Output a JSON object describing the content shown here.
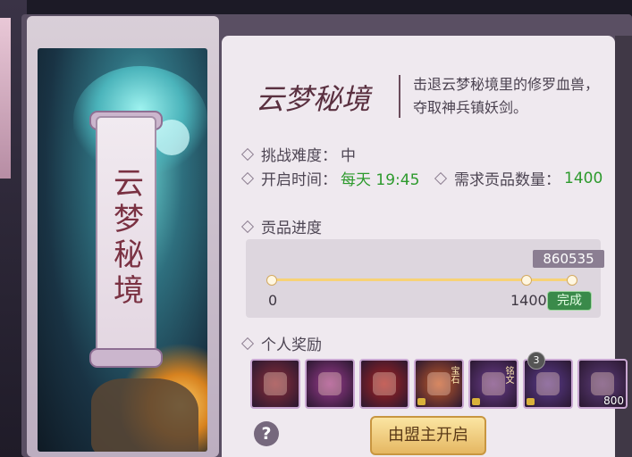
{
  "card": {
    "title": "云梦秘境"
  },
  "header": {
    "calligraphy_title": "云梦秘境",
    "description": "击退云梦秘境里的修罗血兽，夺取神兵镇妖剑。"
  },
  "info": {
    "difficulty_label": "挑战难度：",
    "difficulty_value": "中",
    "open_time_label": "开启时间：",
    "open_time_value": "每天 19:45",
    "required_label": "需求贡品数量：",
    "required_value": "1400"
  },
  "progress": {
    "label": "贡品进度",
    "current": "860535",
    "min": "0",
    "max": "1400",
    "status": "完成",
    "fraction": 1.0
  },
  "rewards": {
    "label": "个人奖励",
    "items": [
      {
        "icon": "staff-icon",
        "color": "#8b2e3a",
        "locked": false
      },
      {
        "icon": "crystal-icon",
        "color": "#9b3c8f",
        "locked": false
      },
      {
        "icon": "sword-icon",
        "color": "#a72222",
        "locked": false
      },
      {
        "icon": "gem-bear-icon",
        "color": "#c25a2a",
        "locked": true,
        "tag": "宝石"
      },
      {
        "icon": "chest-icon",
        "color": "#6a3d8c",
        "locked": true,
        "tag": "铭文"
      },
      {
        "icon": "chest-icon",
        "color": "#5c3c8f",
        "locked": true,
        "badge": "3"
      },
      {
        "icon": "orb-icon",
        "color": "#5d3c7a",
        "locked": false,
        "qty": "800"
      }
    ]
  },
  "footer": {
    "help": "?",
    "open_button": "由盟主开启"
  },
  "colors": {
    "accent_green": "#2d9a2d",
    "title_wine": "#7a3142"
  }
}
